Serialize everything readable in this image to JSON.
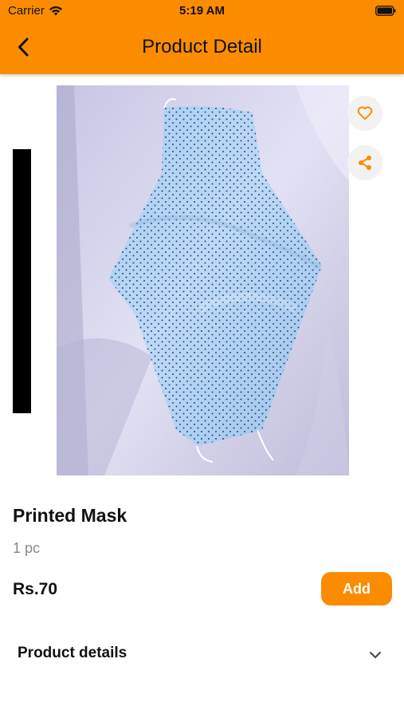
{
  "status_bar": {
    "carrier": "Carrier",
    "time": "5:19 AM",
    "icons": [
      "wifi-icon",
      "battery-icon"
    ]
  },
  "header": {
    "title": "Product Detail",
    "back_icon": "chevron-left-icon",
    "background_color": "#fb8c00"
  },
  "product": {
    "image_description_icon": "product-photo",
    "actions": [
      "heart-icon",
      "share-icon"
    ],
    "name": "Printed Mask",
    "unit": "1 pc",
    "price": "Rs.70",
    "add_label": "Add"
  },
  "details": {
    "label": "Product details",
    "expand_icon": "chevron-down-icon"
  },
  "colors": {
    "accent": "#fb8c00",
    "muted_text": "#8a8a8a",
    "fab_background": "#f2f2f2"
  }
}
